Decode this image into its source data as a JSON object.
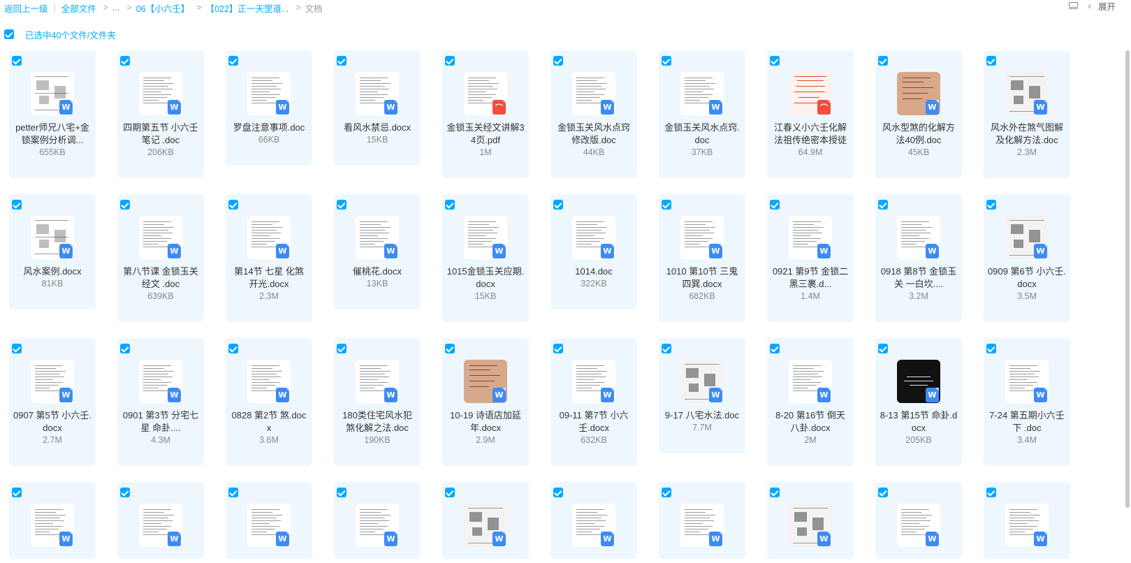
{
  "breadcrumb": {
    "back": "返回上一级",
    "root": "全部文件",
    "ellipsis": "...",
    "folder1": "06【小六壬】",
    "folder2": "【022】正一天罡道...",
    "current": "文档"
  },
  "header": {
    "expand_label": "展开"
  },
  "selection": {
    "label": "已选中40个文件/文件夹"
  },
  "files": [
    {
      "name": "petter师兄八宅+金锁案例分析调...",
      "size": "655KB",
      "type": "word",
      "thumb": "plan"
    },
    {
      "name": "四期第五节 小六壬笔记 .doc",
      "size": "206KB",
      "type": "word",
      "thumb": "text"
    },
    {
      "name": "罗盘注意事项.doc",
      "size": "66KB",
      "type": "word",
      "thumb": "text"
    },
    {
      "name": "看风水禁忌.docx",
      "size": "15KB",
      "type": "word",
      "thumb": "text"
    },
    {
      "name": "金锁玉关经文讲解34页.pdf",
      "size": "1M",
      "type": "pdf",
      "thumb": "text"
    },
    {
      "name": "金锁玉关风水点窍修改版.doc",
      "size": "44KB",
      "type": "word",
      "thumb": "text"
    },
    {
      "name": "金锁玉关风水点窍.doc",
      "size": "37KB",
      "type": "word",
      "thumb": "text"
    },
    {
      "name": "江春义小六壬化解法祖传绝密本授徒",
      "size": "64.9M",
      "type": "pdf",
      "thumb": "red"
    },
    {
      "name": "风水型煞的化解方法40例.doc",
      "size": "45KB",
      "type": "word",
      "thumb": "brown"
    },
    {
      "name": "风水外在煞气图解及化解方法.doc",
      "size": "2.3M",
      "type": "word",
      "thumb": "photo"
    },
    {
      "name": "风水案例.docx",
      "size": "81KB",
      "type": "word",
      "thumb": "plan"
    },
    {
      "name": "第八节课 金锁玉关经文 .doc",
      "size": "639KB",
      "type": "word",
      "thumb": "text"
    },
    {
      "name": "第14节 七星 化煞开光.docx",
      "size": "2.3M",
      "type": "word",
      "thumb": "text"
    },
    {
      "name": "催桃花.docx",
      "size": "13KB",
      "type": "word",
      "thumb": "text"
    },
    {
      "name": "1015金锁玉关应期.docx",
      "size": "15KB",
      "type": "word",
      "thumb": "text"
    },
    {
      "name": "1014.doc",
      "size": "322KB",
      "type": "word",
      "thumb": "text"
    },
    {
      "name": "1010 第10节 三鬼四巽.docx",
      "size": "682KB",
      "type": "word",
      "thumb": "text"
    },
    {
      "name": "0921 第9节 金锁二黑三裹.d...",
      "size": "1.4M",
      "type": "word",
      "thumb": "text"
    },
    {
      "name": "0918 第8节 金锁玉关 一白坎....",
      "size": "3.2M",
      "type": "word",
      "thumb": "text"
    },
    {
      "name": "0909 第6节 小六壬.docx",
      "size": "3.5M",
      "type": "word",
      "thumb": "photo"
    },
    {
      "name": "0907 第5节 小六壬.docx",
      "size": "2.7M",
      "type": "word",
      "thumb": "text"
    },
    {
      "name": "0901 第3节 分宅七星 命卦....",
      "size": "4.3M",
      "type": "word",
      "thumb": "text"
    },
    {
      "name": "0828 第2节 煞.docx",
      "size": "3.6M",
      "type": "word",
      "thumb": "text"
    },
    {
      "name": "180类住宅风水犯煞化解之法.doc",
      "size": "190KB",
      "type": "word",
      "thumb": "text"
    },
    {
      "name": "10-19 诗语店加延年.docx",
      "size": "2.9M",
      "type": "word",
      "thumb": "brown"
    },
    {
      "name": "09-11 第7节 小六壬.docx",
      "size": "632KB",
      "type": "word",
      "thumb": "text"
    },
    {
      "name": "9-17 八宅水法.doc",
      "size": "7.7M",
      "type": "word",
      "thumb": "photo"
    },
    {
      "name": "8-20 第16节 倒天八卦.docx",
      "size": "2M",
      "type": "word",
      "thumb": "text"
    },
    {
      "name": "8-13 第15节 命卦.docx",
      "size": "205KB",
      "type": "word",
      "thumb": "dark"
    },
    {
      "name": "7-24 第五期小六壬下 .doc",
      "size": "3.4M",
      "type": "word",
      "thumb": "text"
    },
    {
      "name": "",
      "size": "",
      "type": "word",
      "thumb": "text"
    },
    {
      "name": "",
      "size": "",
      "type": "word",
      "thumb": "text"
    },
    {
      "name": "",
      "size": "",
      "type": "word",
      "thumb": "text"
    },
    {
      "name": "",
      "size": "",
      "type": "word",
      "thumb": "text"
    },
    {
      "name": "",
      "size": "",
      "type": "word",
      "thumb": "photo"
    },
    {
      "name": "",
      "size": "",
      "type": "word",
      "thumb": "text"
    },
    {
      "name": "",
      "size": "",
      "type": "word",
      "thumb": "text"
    },
    {
      "name": "",
      "size": "",
      "type": "word",
      "thumb": "photo"
    },
    {
      "name": "",
      "size": "",
      "type": "word",
      "thumb": "text"
    },
    {
      "name": "",
      "size": "",
      "type": "word",
      "thumb": "text"
    }
  ],
  "icons": {
    "word_badge": "W",
    "checkbox": "checkmark-icon",
    "view_toggle": "list-view-icon",
    "expand": "chevron-left-icon"
  },
  "colors": {
    "accent": "#06a7ff",
    "card_bg": "#eef7fe",
    "word": "#3d8bf6",
    "pdf": "#f24d3f"
  }
}
